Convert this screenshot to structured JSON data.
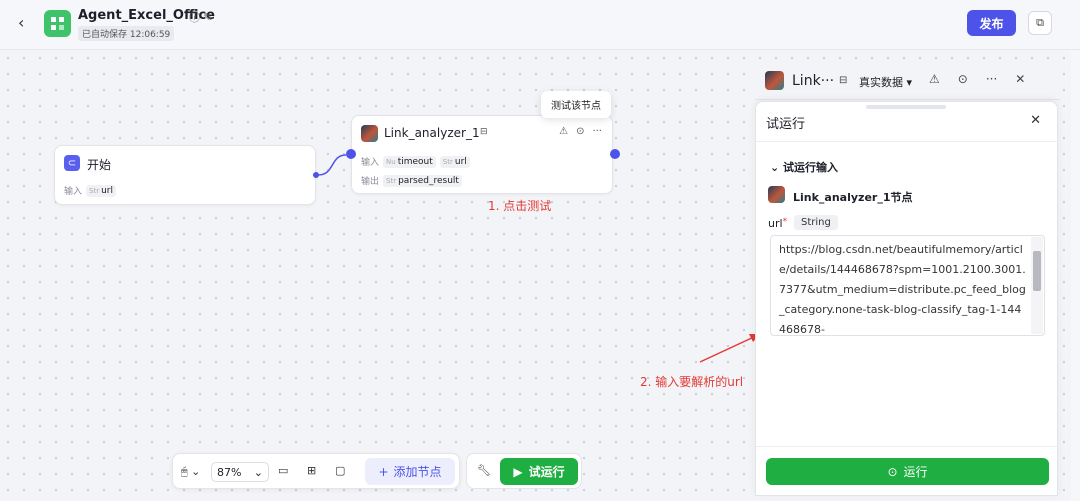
{
  "header": {
    "back_icon": "chevron-left-icon",
    "app_title": "Agent_Excel_Office",
    "autosave": "已自动保存 12:06:59",
    "publish_label": "发布",
    "accent": "#4d53e8"
  },
  "canvas": {
    "start_node": {
      "title": "开始",
      "input_label": "输入",
      "input_type": "Str",
      "input_name": "url"
    },
    "link_node": {
      "title": "Link_analyzer_1",
      "input_label": "输入",
      "inputs": [
        {
          "type": "Nu",
          "name": "timeout"
        },
        {
          "type": "Str",
          "name": "url"
        }
      ],
      "output_label": "输出",
      "output": {
        "type": "Str",
        "name": "parsed_result"
      }
    },
    "tooltip": "测试该节点",
    "annotation_1": "1. 点击测试",
    "annotation_2": "2. 输入要解析的url"
  },
  "toolbar": {
    "zoom": "87%",
    "add_node_label": "添加节点",
    "test_run_label": "试运行",
    "run_color": "#1fae42"
  },
  "right_panel": {
    "node_name": "Link···",
    "mode_label": "真实数据",
    "title": "试运行",
    "section_title": "试运行输入",
    "node_label": "Link_analyzer_1节点",
    "field_name": "url",
    "field_required": "*",
    "field_type": "String",
    "url_value": "https://blog.csdn.net/beautifulmemory/article/details/144468678?spm=1001.2100.3001.7377&utm_medium=distribute.pc_feed_blog_category.none-task-blog-classify_tag-1-144468678-",
    "run_label": "运行"
  }
}
